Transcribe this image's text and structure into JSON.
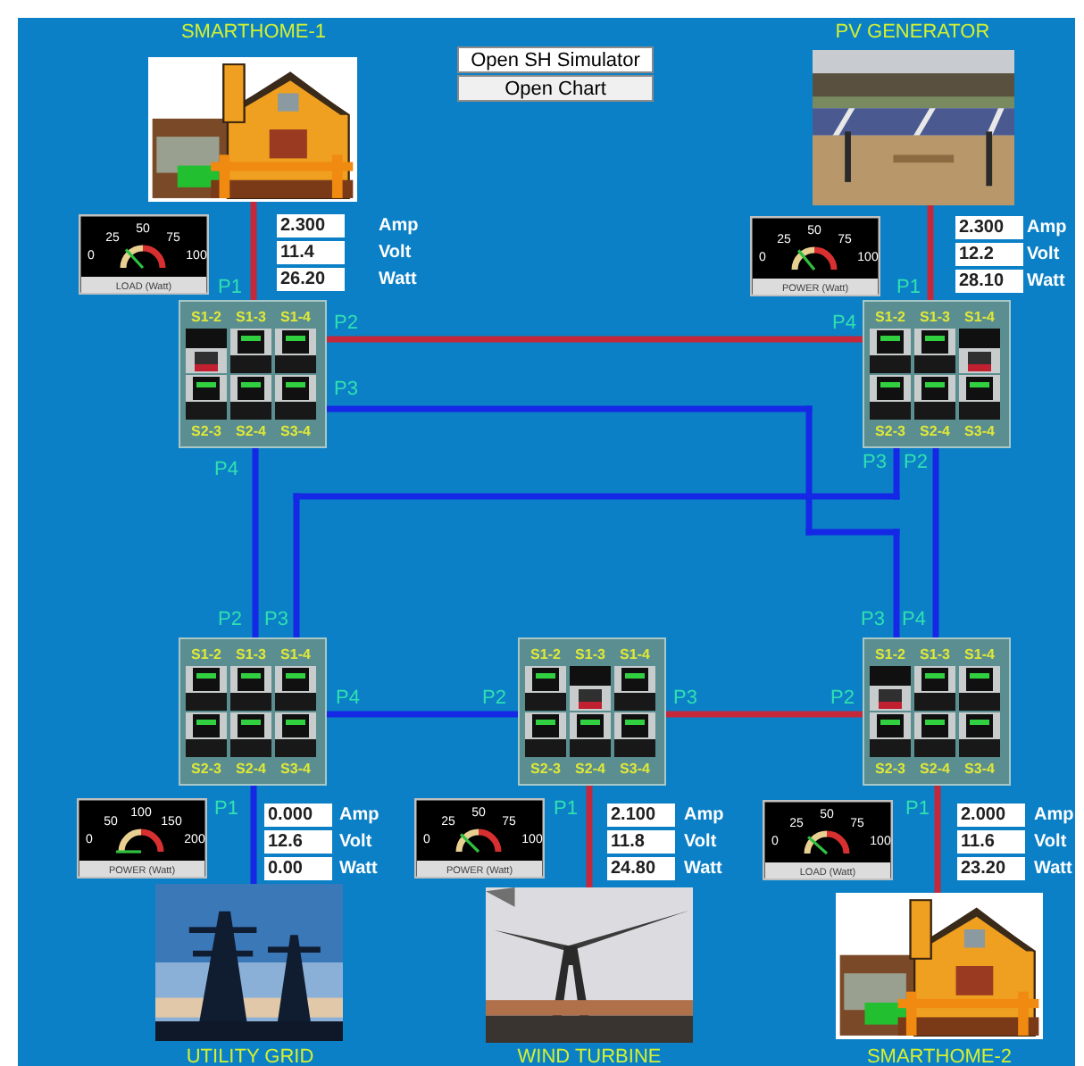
{
  "buttons": [
    {
      "label": "Open SH Simulator"
    },
    {
      "label": "Open Chart"
    }
  ],
  "sites": [
    {
      "title": "SMARTHOME-1",
      "kind": "house",
      "meter": {
        "caption": "LOAD (Watt)",
        "scale": [
          "0",
          "25",
          "50",
          "75",
          "100"
        ]
      },
      "readings": [
        {
          "value": "2.300",
          "unit": "Amp"
        },
        {
          "value": "11.4",
          "unit": "Volt"
        },
        {
          "value": "26.20",
          "unit": "Watt"
        }
      ],
      "switchbox": {
        "switches": [
          {
            "label": "S1-2",
            "on": false
          },
          {
            "label": "S1-3",
            "on": true
          },
          {
            "label": "S1-4",
            "on": true
          },
          {
            "label": "S2-3",
            "on": true
          },
          {
            "label": "S2-4",
            "on": true
          },
          {
            "label": "S3-4",
            "on": true
          }
        ],
        "ports": [
          "P1",
          "P2",
          "P3",
          "P4"
        ]
      }
    },
    {
      "title": "PV GENERATOR",
      "kind": "solar",
      "meter": {
        "caption": "POWER (Watt)",
        "scale": [
          "0",
          "25",
          "50",
          "75",
          "100"
        ]
      },
      "readings": [
        {
          "value": "2.300",
          "unit": "Amp"
        },
        {
          "value": "12.2",
          "unit": "Volt"
        },
        {
          "value": "28.10",
          "unit": "Watt"
        }
      ],
      "switchbox": {
        "switches": [
          {
            "label": "S1-2",
            "on": true
          },
          {
            "label": "S1-3",
            "on": true
          },
          {
            "label": "S1-4",
            "on": false
          },
          {
            "label": "S2-3",
            "on": true
          },
          {
            "label": "S2-4",
            "on": true
          },
          {
            "label": "S3-4",
            "on": true
          }
        ],
        "ports": [
          "P1",
          "P4",
          "P3",
          "P2"
        ]
      }
    },
    {
      "title": "UTILITY GRID",
      "kind": "pylons",
      "meter": {
        "caption": "POWER (Watt)",
        "scale": [
          "0",
          "50",
          "100",
          "150",
          "200"
        ]
      },
      "readings": [
        {
          "value": "0.000",
          "unit": "Amp"
        },
        {
          "value": "12.6",
          "unit": "Volt"
        },
        {
          "value": "0.00",
          "unit": "Watt"
        }
      ],
      "switchbox": {
        "switches": [
          {
            "label": "S1-2",
            "on": true
          },
          {
            "label": "S1-3",
            "on": true
          },
          {
            "label": "S1-4",
            "on": true
          },
          {
            "label": "S2-3",
            "on": true
          },
          {
            "label": "S2-4",
            "on": true
          },
          {
            "label": "S3-4",
            "on": true
          }
        ],
        "ports": [
          "P2",
          "P3",
          "P1",
          "P4"
        ]
      }
    },
    {
      "title": "WIND TURBINE",
      "kind": "wind",
      "meter": {
        "caption": "POWER (Watt)",
        "scale": [
          "0",
          "25",
          "50",
          "75",
          "100"
        ]
      },
      "readings": [
        {
          "value": "2.100",
          "unit": "Amp"
        },
        {
          "value": "11.8",
          "unit": "Volt"
        },
        {
          "value": "24.80",
          "unit": "Watt"
        }
      ],
      "switchbox": {
        "switches": [
          {
            "label": "S1-2",
            "on": true
          },
          {
            "label": "S1-3",
            "on": false
          },
          {
            "label": "S1-4",
            "on": true
          },
          {
            "label": "S2-3",
            "on": true
          },
          {
            "label": "S2-4",
            "on": true
          },
          {
            "label": "S3-4",
            "on": true
          }
        ],
        "ports": [
          "P2",
          "P3",
          "P1"
        ]
      }
    },
    {
      "title": "SMARTHOME-2",
      "kind": "house",
      "meter": {
        "caption": "LOAD (Watt)",
        "scale": [
          "0",
          "25",
          "50",
          "75",
          "100"
        ]
      },
      "readings": [
        {
          "value": "2.000",
          "unit": "Amp"
        },
        {
          "value": "11.6",
          "unit": "Volt"
        },
        {
          "value": "23.20",
          "unit": "Watt"
        }
      ],
      "switchbox": {
        "switches": [
          {
            "label": "S1-2",
            "on": false
          },
          {
            "label": "S1-3",
            "on": true
          },
          {
            "label": "S1-4",
            "on": true
          },
          {
            "label": "S2-3",
            "on": true
          },
          {
            "label": "S2-4",
            "on": true
          },
          {
            "label": "S3-4",
            "on": true
          }
        ],
        "ports": [
          "P3",
          "P4",
          "P2",
          "P1"
        ]
      }
    }
  ],
  "links": [
    {
      "color": "#c4283a"
    },
    {
      "color": "#c4283a"
    },
    {
      "color": "#1428e6"
    },
    {
      "color": "#1428e6"
    },
    {
      "color": "#1428e6"
    },
    {
      "color": "#1428e6"
    },
    {
      "color": "#1428e6"
    },
    {
      "color": "#c4283a"
    },
    {
      "color": "#c4283a"
    },
    {
      "color": "#1428e6"
    },
    {
      "color": "#c4283a"
    },
    {
      "color": "#c4283a"
    }
  ]
}
